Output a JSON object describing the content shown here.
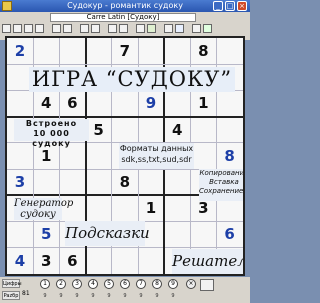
{
  "window": {
    "title": "Судокур - романтик судоку"
  },
  "toolbar": {
    "font_value": "Carre Latin [Судоку]"
  },
  "board": {
    "digits": [
      {
        "r": 0,
        "c": 0,
        "v": "2",
        "color": "blue"
      },
      {
        "r": 0,
        "c": 4,
        "v": "7",
        "color": "black"
      },
      {
        "r": 0,
        "c": 7,
        "v": "8",
        "color": "black"
      },
      {
        "r": 2,
        "c": 1,
        "v": "4",
        "color": "black"
      },
      {
        "r": 2,
        "c": 2,
        "v": "6",
        "color": "black"
      },
      {
        "r": 2,
        "c": 5,
        "v": "9",
        "color": "blue"
      },
      {
        "r": 2,
        "c": 7,
        "v": "1",
        "color": "black"
      },
      {
        "r": 3,
        "c": 3,
        "v": "5",
        "color": "black"
      },
      {
        "r": 3,
        "c": 6,
        "v": "4",
        "color": "black"
      },
      {
        "r": 4,
        "c": 1,
        "v": "1",
        "color": "black"
      },
      {
        "r": 4,
        "c": 8,
        "v": "8",
        "color": "blue"
      },
      {
        "r": 5,
        "c": 0,
        "v": "3",
        "color": "blue"
      },
      {
        "r": 5,
        "c": 4,
        "v": "8",
        "color": "black"
      },
      {
        "r": 6,
        "c": 5,
        "v": "1",
        "color": "black"
      },
      {
        "r": 6,
        "c": 7,
        "v": "3",
        "color": "black"
      },
      {
        "r": 7,
        "c": 1,
        "v": "5",
        "color": "blue"
      },
      {
        "r": 7,
        "c": 8,
        "v": "6",
        "color": "blue"
      },
      {
        "r": 8,
        "c": 0,
        "v": "4",
        "color": "blue"
      },
      {
        "r": 8,
        "c": 1,
        "v": "3",
        "color": "black"
      },
      {
        "r": 8,
        "c": 2,
        "v": "6",
        "color": "black"
      }
    ]
  },
  "overlays": {
    "title": "ИГРА “СУДОКУ”",
    "built_in_1": "Встроено",
    "built_in_2": "10 000 судоку",
    "formats_1": "Форматы данных",
    "formats_2": "sdk,ss,txt,sud,sdr",
    "copy_1": "Копирование",
    "copy_2": "Вставка",
    "copy_3": "Сохранение...",
    "generator_1": "Генератор",
    "generator_2": "судоку",
    "hints": "Подсказки",
    "solver": "Решатель"
  },
  "bottom": {
    "digits_label": "Цифры",
    "values_label": "Pazбр",
    "values_count": "81",
    "digit_buttons": [
      "1",
      "2",
      "3",
      "4",
      "5",
      "6",
      "7",
      "8",
      "9"
    ],
    "digit_counts": [
      "9",
      "9",
      "9",
      "9",
      "9",
      "9",
      "9",
      "9",
      "9"
    ]
  },
  "colors": {
    "blue_digit": "#1d3fa7",
    "black_digit": "#111111",
    "title_bar": "#2a56b0"
  }
}
